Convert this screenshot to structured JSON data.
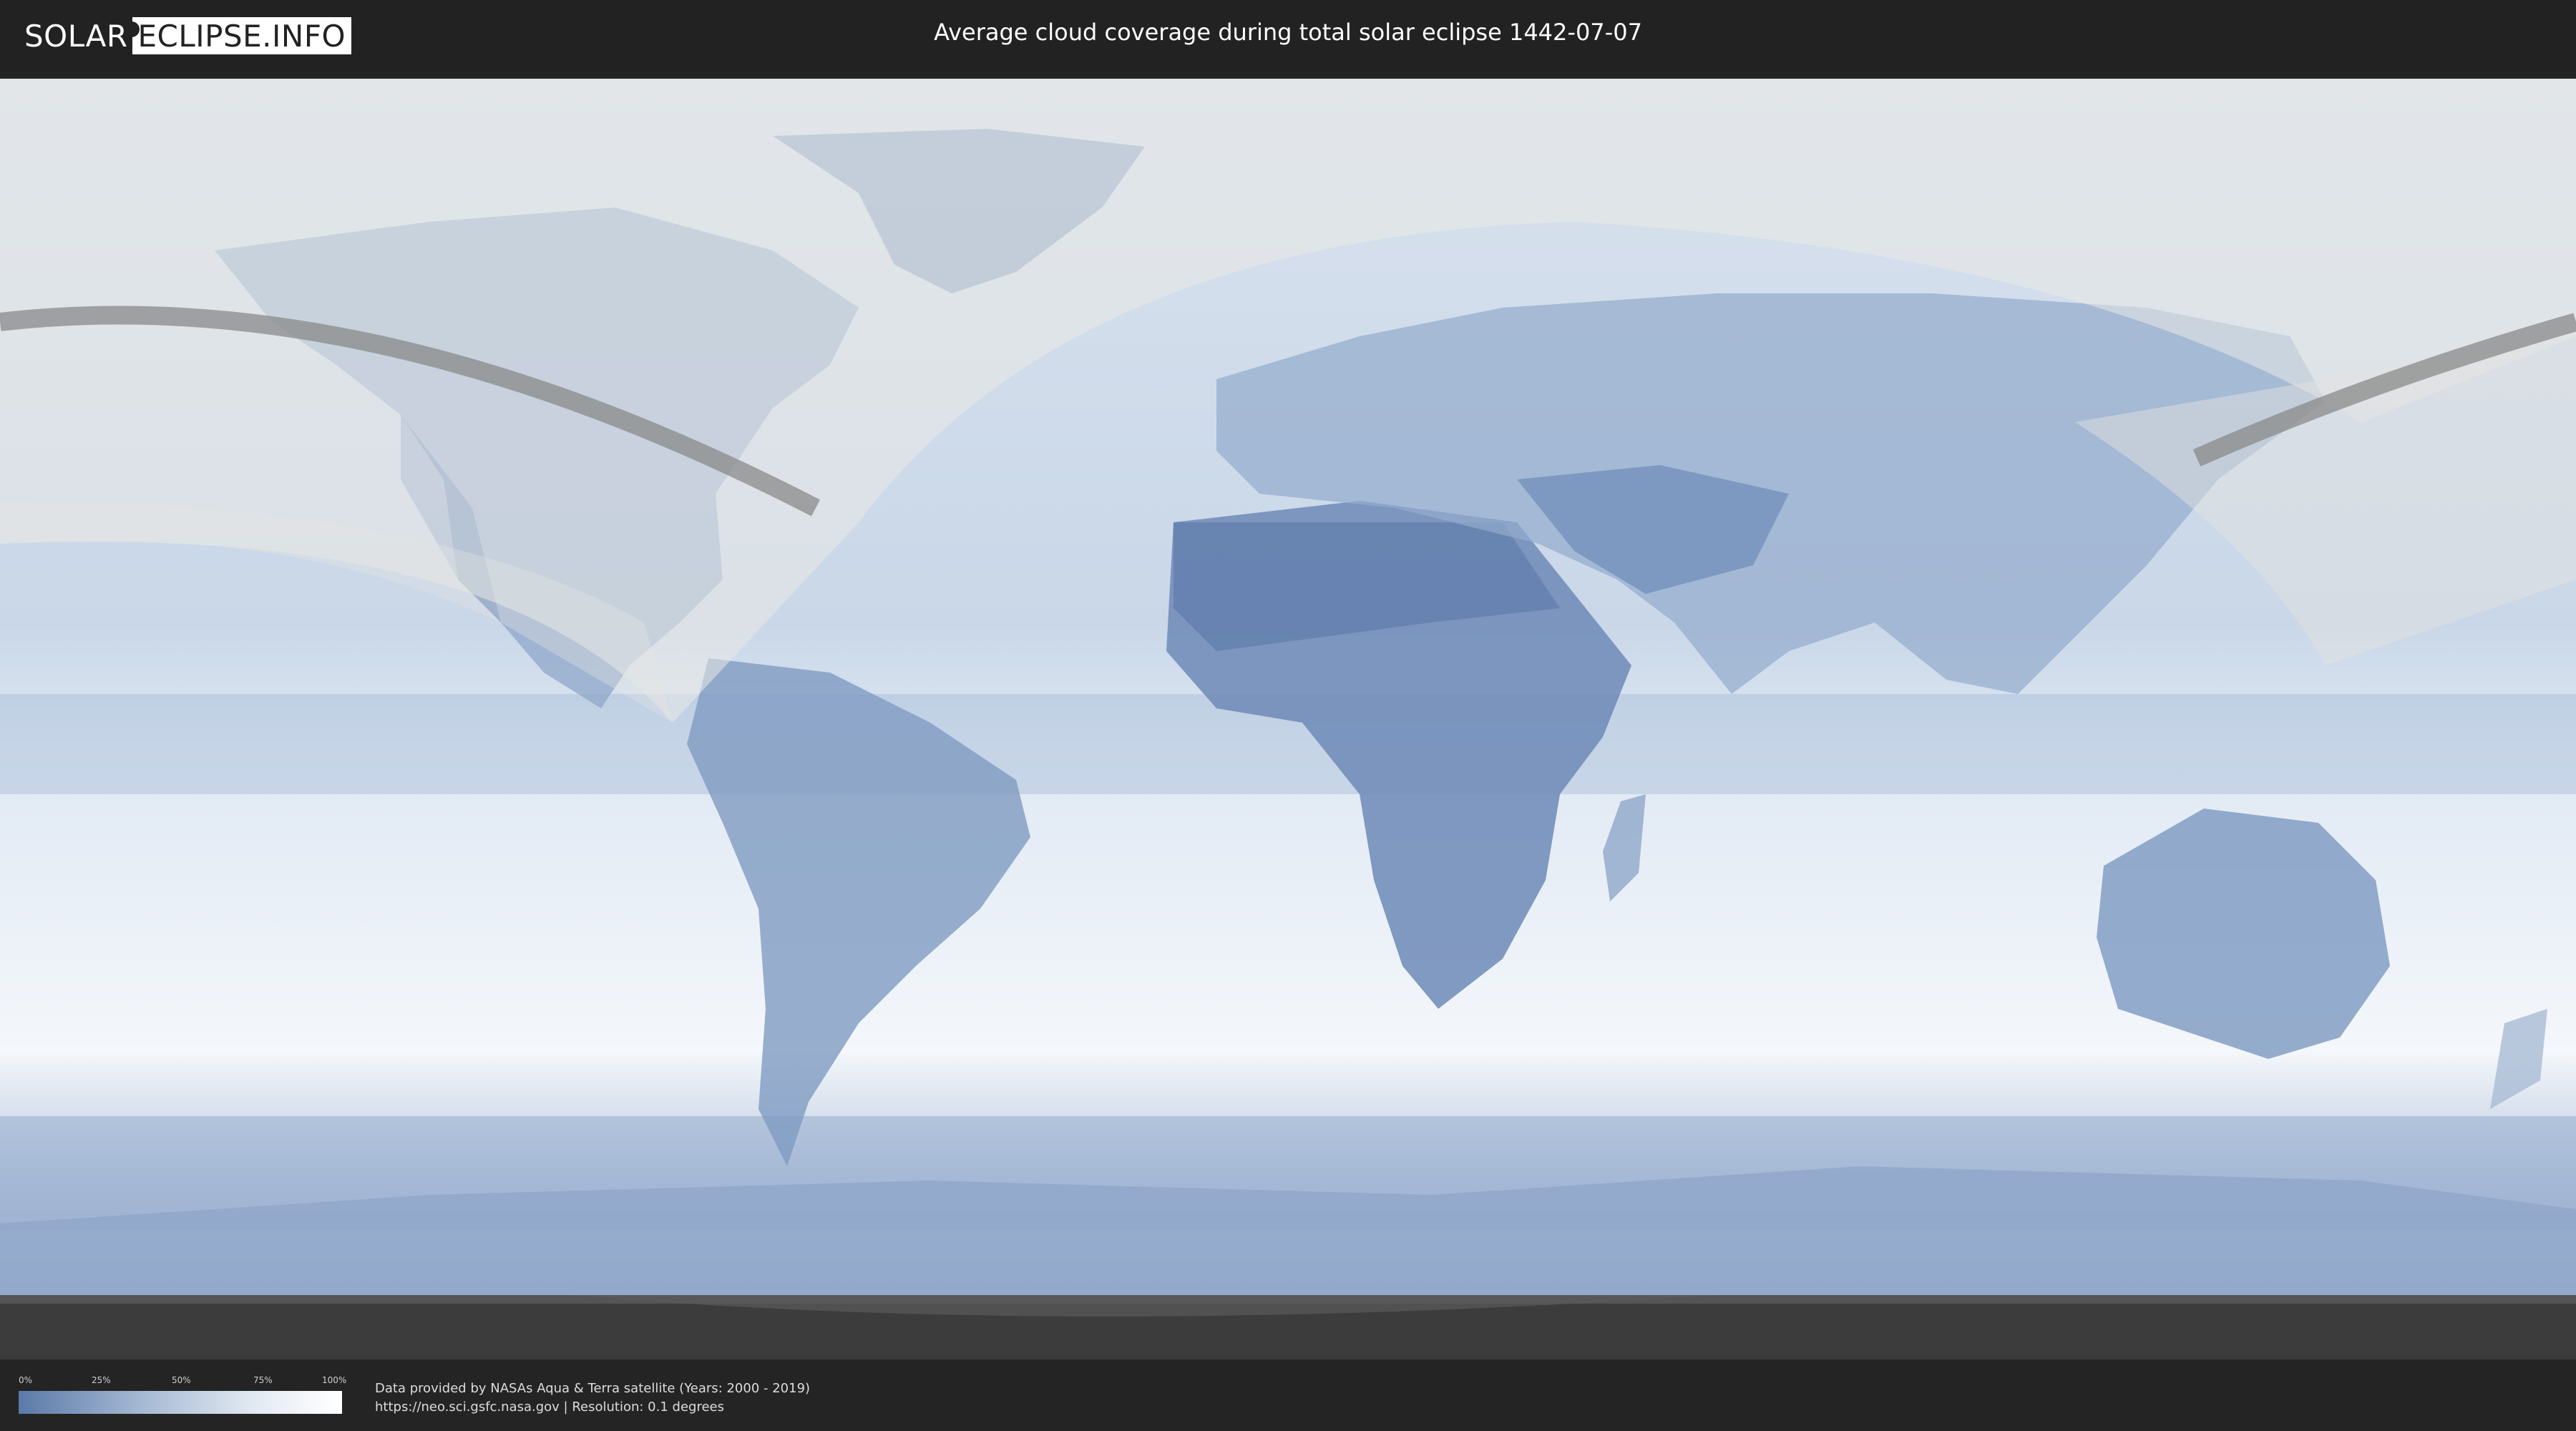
{
  "header": {
    "logo_left": "SOLAR",
    "logo_right": "ECLIPSE.INFO",
    "title": "Average cloud coverage during total solar eclipse 1442-07-07"
  },
  "legend": {
    "ticks": [
      "0%",
      "25%",
      "50%",
      "75%",
      "100%"
    ],
    "gradient_colors": [
      "#5b7aa8",
      "#a9bcd5",
      "#e6ecf4",
      "#ffffff"
    ]
  },
  "credits": {
    "line1": "Data provided by NASAs Aqua & Terra satellite (Years: 2000 - 2019)",
    "line2": "https://neo.sci.gsfc.nasa.gov | Resolution: 0.1 degrees"
  },
  "colors": {
    "ocean_clear": "#eef3f9",
    "cloud_dark": "#6f8db8",
    "eclipse_path": "#8a8a8a",
    "night_overlay": "#cfcfcf"
  }
}
